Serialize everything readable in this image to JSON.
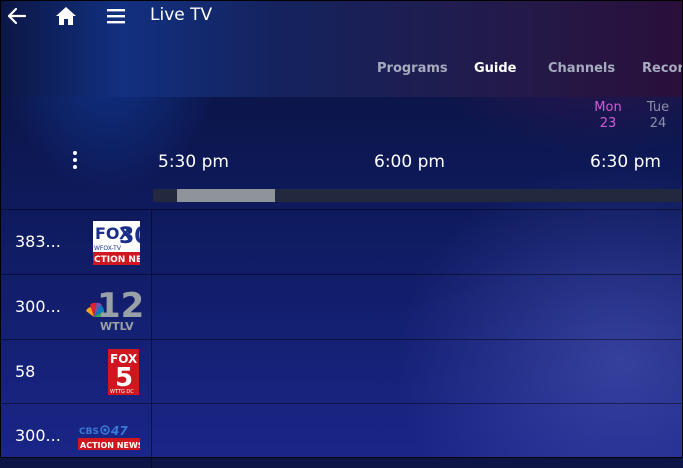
{
  "header": {
    "title": "Live TV",
    "tabs": [
      {
        "label": "Programs",
        "active": false
      },
      {
        "label": "Guide",
        "active": true
      },
      {
        "label": "Channels",
        "active": false
      },
      {
        "label": "Recordings",
        "active": false
      }
    ]
  },
  "dates": [
    {
      "day": "Mon",
      "num": "23",
      "color": "#d45bd8"
    },
    {
      "day": "Tue",
      "num": "24",
      "color": "#8a8fa6"
    }
  ],
  "times": [
    "5:30 pm",
    "6:00 pm",
    "6:30 pm"
  ],
  "channels": [
    {
      "number": "383...",
      "logo": "FOX 30 WFOX-TV Action News",
      "logo_text": {
        "brand": "FOX",
        "num": "30",
        "call": "WFOX-TV",
        "tag": "CTION NEW"
      }
    },
    {
      "number": "300...",
      "logo": "NBC 12 WTLV",
      "logo_text": {
        "num": "12",
        "call": "WTLV"
      }
    },
    {
      "number": "58",
      "logo": "FOX 5 WTTG DC",
      "logo_text": {
        "brand": "FOX",
        "num": "5",
        "call": "WTTG DC"
      }
    },
    {
      "number": "300...",
      "logo": "CBS 47 Action News",
      "logo_text": {
        "brand": "CBS",
        "num": "47",
        "tag": "ACTION NEWS"
      }
    }
  ],
  "colors": {
    "accent_date": "#d45bd8",
    "background": "#0e1a5c"
  }
}
